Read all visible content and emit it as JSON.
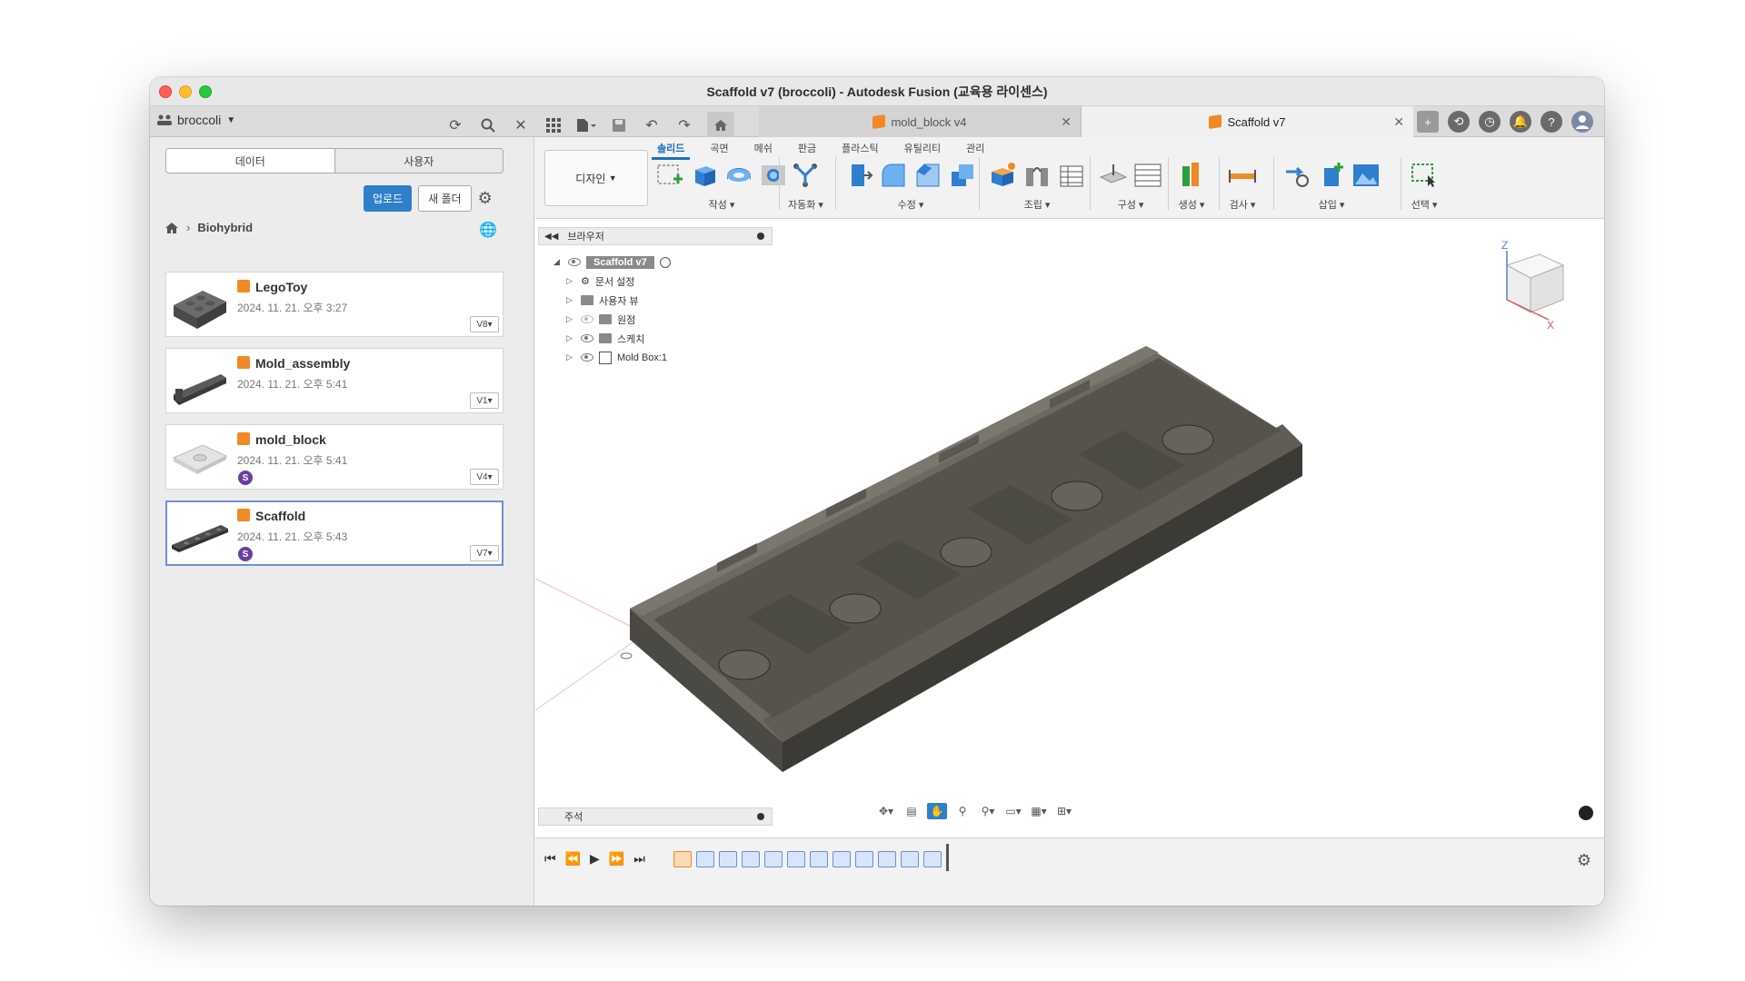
{
  "window": {
    "title": "Scaffold v7 (broccoli) - Autodesk Fusion (교육용 라이센스)"
  },
  "project": {
    "name": "broccoli"
  },
  "tabs": [
    {
      "label": "mold_block v4",
      "active": false
    },
    {
      "label": "Scaffold v7",
      "active": true
    }
  ],
  "data_panel": {
    "segments": [
      "데이터",
      "사용자"
    ],
    "upload_label": "업로드",
    "new_folder_label": "새 폴더",
    "breadcrumb": "Biohybrid",
    "files": [
      {
        "name": "LegoToy",
        "date": "2024. 11. 21. 오후 3:27",
        "version": "V8",
        "shared": false
      },
      {
        "name": "Mold_assembly",
        "date": "2024. 11. 21. 오후 5:41",
        "version": "V1",
        "shared": false
      },
      {
        "name": "mold_block",
        "date": "2024. 11. 21. 오후 5:41",
        "version": "V4",
        "shared": true,
        "badge": "S"
      },
      {
        "name": "Scaffold",
        "date": "2024. 11. 21. 오후 5:43",
        "version": "V7",
        "shared": true,
        "badge": "S",
        "selected": true
      }
    ]
  },
  "toolbar": {
    "workspace": "디자인",
    "ribbon_tabs": [
      "솔리드",
      "곡면",
      "메쉬",
      "판금",
      "플라스틱",
      "유틸리티",
      "관리"
    ],
    "active_ribbon_tab": "솔리드",
    "groups": [
      "작성",
      "자동화",
      "수정",
      "조립",
      "구성",
      "생성",
      "검사",
      "삽입",
      "선택"
    ]
  },
  "browser": {
    "title": "브라우저",
    "root": "Scaffold v7",
    "items": [
      "문서 설정",
      "사용자 뷰",
      "원점",
      "스케치",
      "Mold Box:1"
    ]
  },
  "notes": {
    "title": "주석"
  },
  "viewcube": {
    "z_label": "Z",
    "x_label": "X"
  },
  "colors": {
    "accent": "#2e80c8",
    "model": "#55534b",
    "badge": "#6b3fa0",
    "cube": "#f08a24"
  }
}
